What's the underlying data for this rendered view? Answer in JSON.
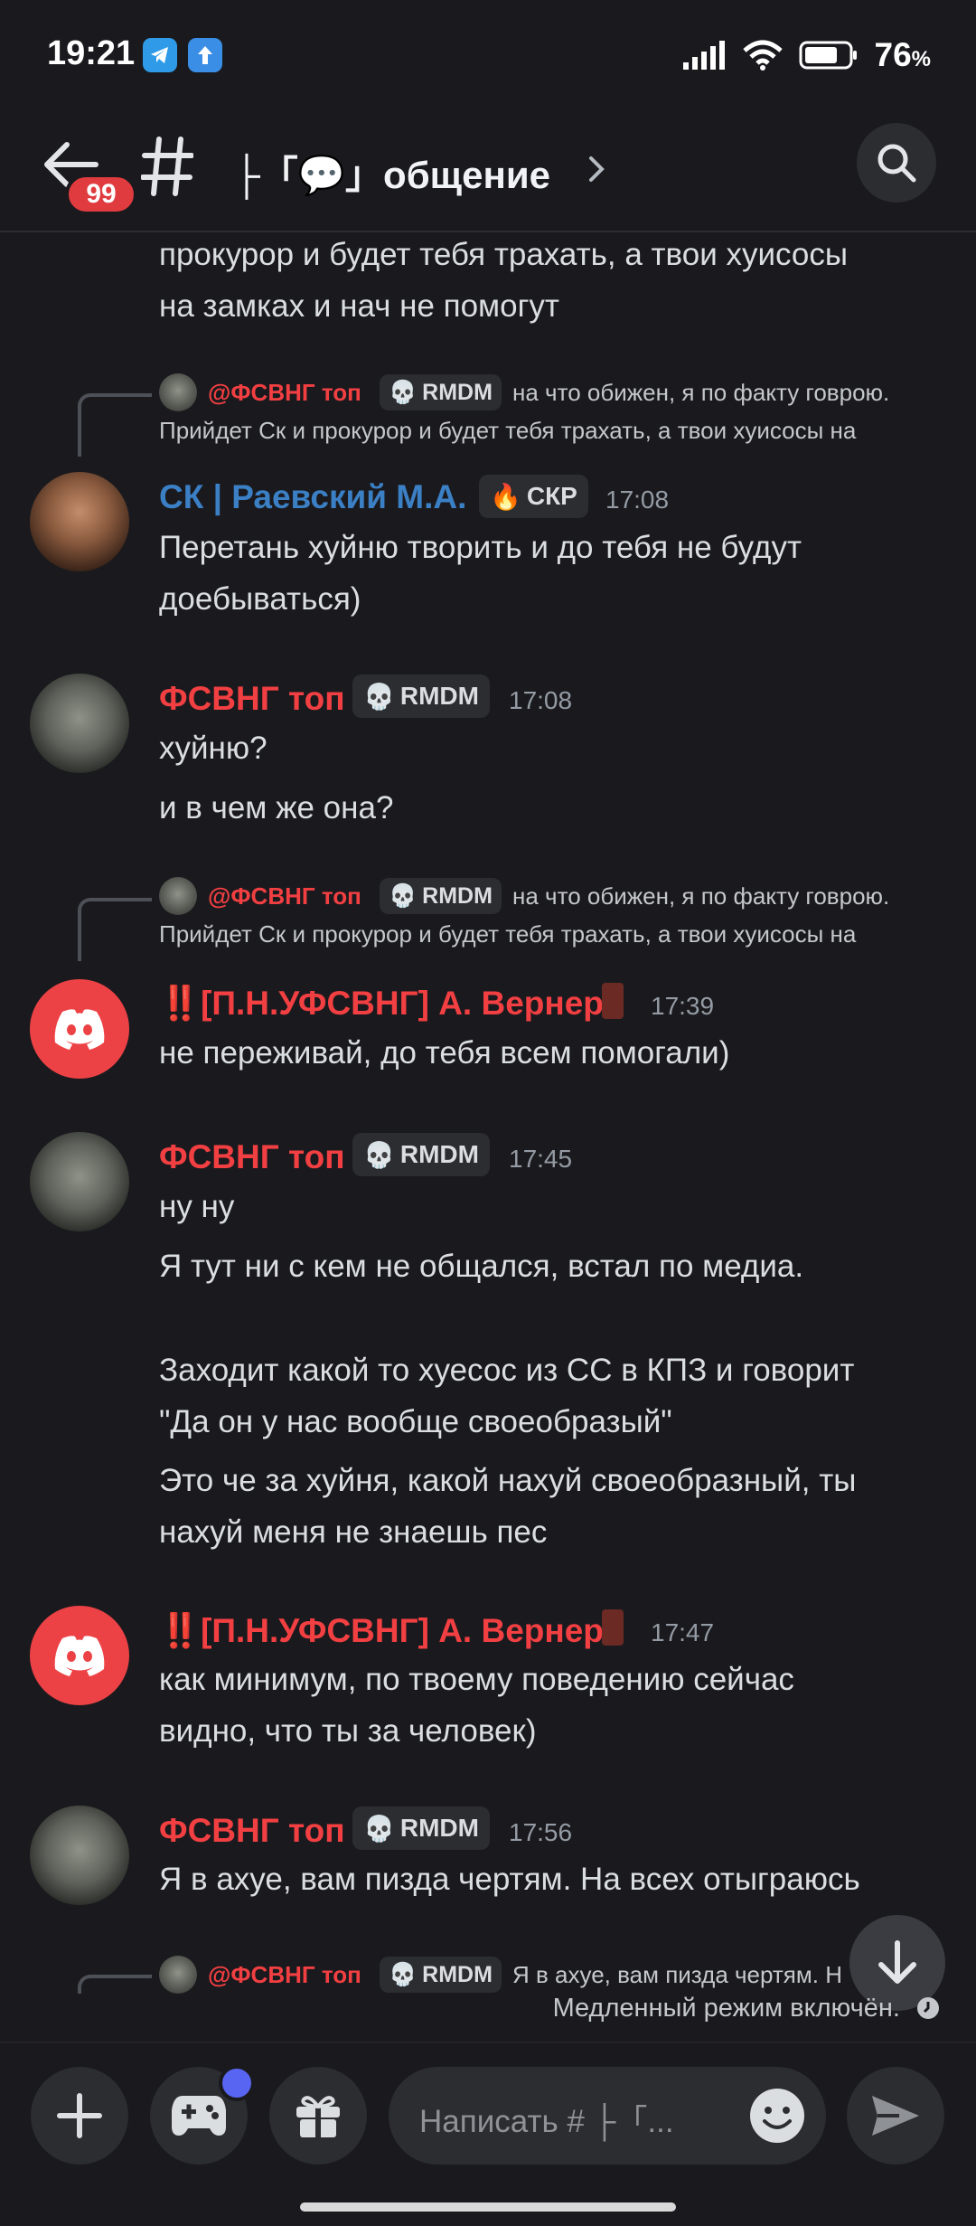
{
  "status_bar": {
    "time": "19:21",
    "battery": "76",
    "battery_unit": "%"
  },
  "header": {
    "badge": "99",
    "channel_name": "├「💬」общение"
  },
  "messages_top_text": {
    "line1": "прокурор и будет тебя трахать, а твои хуисосы",
    "line2": "на замках и нач не помогут"
  },
  "reply1": {
    "name": "@ФСВНГ топ",
    "tag": "RMDM",
    "line1": "на что обижен, я по факту говрою.",
    "line2": "Прийдет Ск и прокурор и будет тебя трахать, а твои хуисосы на"
  },
  "msg_sk": {
    "name": "СК | Раевский М.А.",
    "tag": "СКР",
    "time": "17:08",
    "line1": "Перетань хуйню творить и до тебя не будут",
    "line2": "доебываться)"
  },
  "msg_fsvng1": {
    "name": "ФСВНГ топ",
    "tag": "RMDM",
    "time": "17:08",
    "line1": "хуйню?",
    "line2": "и в чем же она?"
  },
  "reply2": {
    "name": "@ФСВНГ топ",
    "tag": "RMDM",
    "line1": "на что обижен, я по факту говрою.",
    "line2": "Прийдет Ск и прокурор и будет тебя трахать, а твои хуисосы на"
  },
  "msg_verner1": {
    "name": "‼️[П.Н.УФСВНГ] А. Вернер",
    "time": "17:39",
    "line1": "не переживай, до тебя всем помогали)"
  },
  "msg_fsvng2": {
    "name": "ФСВНГ топ",
    "tag": "RMDM",
    "time": "17:45",
    "line1": "ну ну",
    "line2": "Я тут ни с кем не общался, встал по медиа.",
    "line3": "Заходит какой то хуесос из СС в КПЗ и говорит",
    "line4": "\"Да он у нас вообще своеобразый\"",
    "line5": "Это че за хуйня, какой нахуй своеобразный, ты",
    "line6": "нахуй меня не знаешь пес"
  },
  "msg_verner2": {
    "name": "‼️[П.Н.УФСВНГ] А. Вернер",
    "time": "17:47",
    "line1": "как минимум, по твоему поведению сейчас",
    "line2": "видно, что ты за человек)"
  },
  "msg_fsvng3": {
    "name": "ФСВНГ топ",
    "tag": "RMDM",
    "time": "17:56",
    "line1": "Я в ахуе, вам пизда чертям. На всех отыграюсь"
  },
  "reply3": {
    "name": "@ФСВНГ топ",
    "tag": "RMDM",
    "line1": "Я в ахуе, вам пизда чертям. Н"
  },
  "slowmode": "Медленный режим включён.",
  "composer": {
    "placeholder": "Написать # ├「..."
  },
  "colors": {
    "bg": "#1a1a1e",
    "username_red": "#f23f42",
    "username_blue": "#3b7fc4",
    "discord_red": "#ed4245",
    "blurple": "#5865f2"
  }
}
